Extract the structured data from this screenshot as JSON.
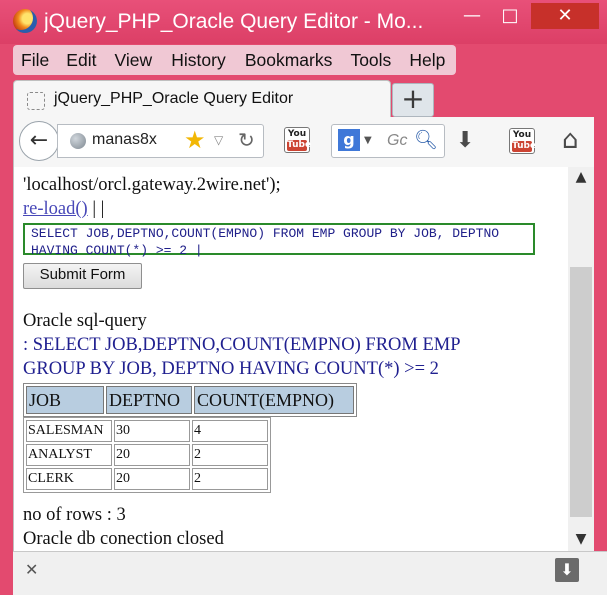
{
  "window": {
    "title": "jQuery_PHP_Oracle Query Editor - Mo...",
    "minimize_label": "—",
    "maximize_label": "□",
    "close_label": "✕"
  },
  "menu": [
    "File",
    "Edit",
    "View",
    "History",
    "Bookmarks",
    "Tools",
    "Help"
  ],
  "tab": {
    "label": "jQuery_PHP_Oracle Query Editor",
    "new_tab_label": "+"
  },
  "navigation": {
    "url": "manas8x",
    "search_placeholder": "Gc",
    "search_engine": "g",
    "youtube_top": "You",
    "youtube_bottom": "Tube"
  },
  "page": {
    "connect_line": "'localhost/orcl.gateway.2wire.net');",
    "reload_link": "re-load()",
    "reload_suffix": " | |",
    "sql_text": " SELECT JOB,DEPTNO,COUNT(EMPNO) FROM EMP GROUP BY JOB, DEPTNO HAVING COUNT(*) >= 2 |",
    "submit_label": "Submit Form",
    "result_heading": "Oracle sql-query",
    "query_line1": ": SELECT JOB,DEPTNO,COUNT(EMPNO) FROM EMP",
    "query_line2": "GROUP BY JOB, DEPTNO HAVING COUNT(*) >= 2",
    "columns": [
      "JOB",
      "DEPTNO",
      "COUNT(EMPNO)"
    ],
    "rows": [
      [
        "SALESMAN",
        "30",
        "4"
      ],
      [
        "ANALYST",
        "20",
        "2"
      ],
      [
        "CLERK",
        "20",
        "2"
      ]
    ],
    "row_count": "no of rows : 3",
    "closed_message": "Oracle db conection closed"
  },
  "colors": {
    "window_frame": "#e34a6f",
    "query_text": "#202090",
    "table_header": "#b8cde0",
    "sql_border": "#2a8a2a"
  }
}
